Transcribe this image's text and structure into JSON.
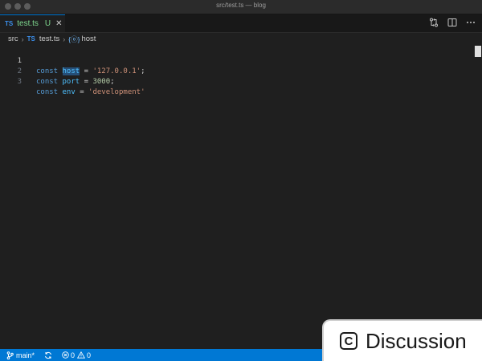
{
  "window": {
    "title": "src/test.ts — blog"
  },
  "tab": {
    "lang": "TS",
    "name": "test.ts",
    "status": "U",
    "close": "✕"
  },
  "breadcrumb": {
    "folder": "src",
    "file_lang": "TS",
    "file": "test.ts",
    "symbol_icon": "{ⓞ}",
    "symbol": "host"
  },
  "editor": {
    "lines": [
      {
        "number": "1",
        "kw": "const",
        "name": "host",
        "op": "=",
        "value": "'127.0.0.1'",
        "end": ";"
      },
      {
        "number": "2",
        "kw": "const",
        "name": "port",
        "op": "=",
        "value": "3000",
        "end": ";"
      },
      {
        "number": "3",
        "kw": "const",
        "name": "env",
        "op": "=",
        "value": "'development'",
        "end": ""
      }
    ]
  },
  "statusbar": {
    "branch": "main*",
    "errors": "0",
    "warnings": "0"
  },
  "overlay": {
    "label": "Discussion",
    "icon_letter": "C"
  },
  "colors": {
    "accent": "#0078d4",
    "keyword": "#569cd6",
    "string": "#ce9178",
    "number": "#b5cea8"
  },
  "icons": [
    "git-compare-icon",
    "split-editor-icon",
    "more-actions-icon",
    "git-branch-icon",
    "sync-icon",
    "error-icon",
    "warning-icon"
  ]
}
